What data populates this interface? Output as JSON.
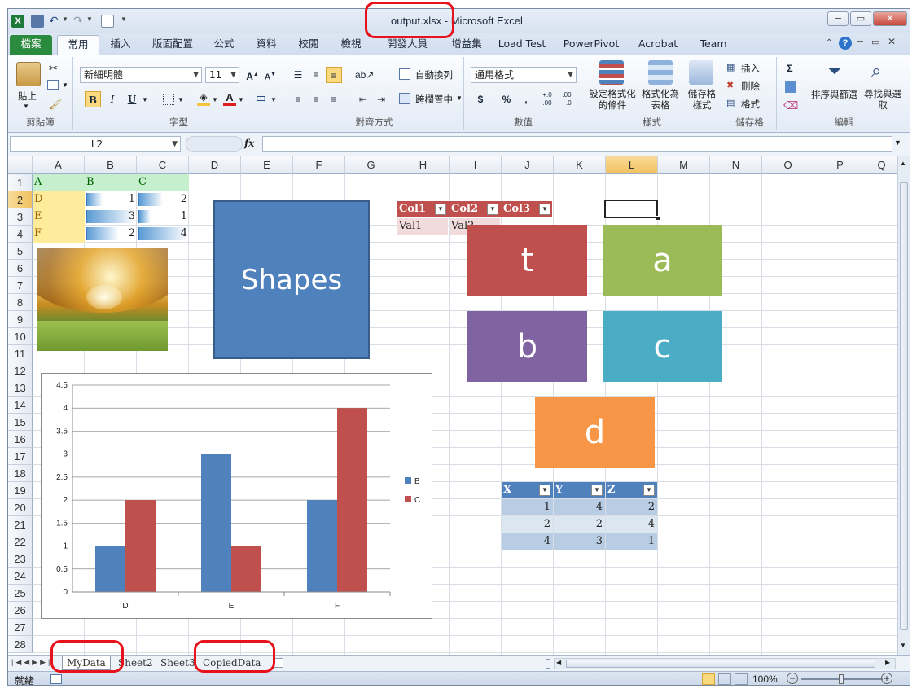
{
  "window": {
    "title": "output.xlsx - Microsoft Excel"
  },
  "tabs": [
    {
      "label": "檔案"
    },
    {
      "label": "常用"
    },
    {
      "label": "插入"
    },
    {
      "label": "版面配置"
    },
    {
      "label": "公式"
    },
    {
      "label": "資料"
    },
    {
      "label": "校閱"
    },
    {
      "label": "檢視"
    },
    {
      "label": "開發人員"
    },
    {
      "label": "增益集"
    },
    {
      "label": "Load Test"
    },
    {
      "label": "PowerPivot"
    },
    {
      "label": "Acrobat"
    },
    {
      "label": "Team"
    }
  ],
  "ribbon": {
    "clipboard": {
      "paste": "貼上",
      "label": "剪貼簿"
    },
    "font": {
      "name": "新細明體",
      "size": "11",
      "bold": "B",
      "italic": "I",
      "underline": "U",
      "label": "字型"
    },
    "alignment": {
      "wrap": "自動換列",
      "merge": "跨欄置中",
      "label": "對齊方式"
    },
    "number": {
      "format": "通用格式",
      "currency": "$",
      "percent": "%",
      "comma": ",",
      "inc": "+.0 .00",
      "dec": ".00 +.0",
      "label": "數值"
    },
    "styles": {
      "conditional": "設定格式化的條件",
      "as_table": "格式化為表格",
      "cell_styles": "儲存格樣式",
      "label": "樣式"
    },
    "cells": {
      "insert": "插入",
      "delete": "刪除",
      "format": "格式",
      "label": "儲存格"
    },
    "editing": {
      "sum": "Σ",
      "sort": "排序與篩選",
      "find": "尋找與選取",
      "label": "編輯"
    }
  },
  "formula_bar": {
    "name_box": "L2",
    "fx": "fx",
    "formula": ""
  },
  "columns": [
    "A",
    "B",
    "C",
    "D",
    "E",
    "F",
    "G",
    "H",
    "I",
    "J",
    "K",
    "L",
    "M",
    "N",
    "O",
    "P",
    "Q"
  ],
  "rows": [
    "1",
    "2",
    "3",
    "4",
    "5",
    "6",
    "7",
    "8",
    "9",
    "10",
    "11",
    "12",
    "13",
    "14",
    "15",
    "16",
    "17",
    "18",
    "19",
    "20",
    "21",
    "22",
    "23",
    "24",
    "25",
    "26",
    "27",
    "28"
  ],
  "cells": {
    "a1": "A",
    "b1": "B",
    "c1": "C",
    "a2": "D",
    "a3": "E",
    "a4": "F",
    "b2": "1",
    "b3": "3",
    "b4": "2",
    "c2": "2",
    "c3": "1",
    "c4": "4"
  },
  "databars": {
    "b": [
      0.33,
      1.0,
      0.67
    ],
    "c": [
      0.5,
      0.25,
      1.0
    ]
  },
  "table1": {
    "headers": [
      "Col1",
      "Col2",
      "Col3"
    ],
    "row": [
      "Val1",
      "Val2",
      ""
    ]
  },
  "table2": {
    "headers": [
      "X",
      "Y",
      "Z"
    ],
    "rows": [
      [
        "1",
        "4",
        "2"
      ],
      [
        "2",
        "2",
        "4"
      ],
      [
        "4",
        "3",
        "1"
      ]
    ]
  },
  "shapes": {
    "main": {
      "text": "Shapes",
      "color": "#4f81bd"
    },
    "t": {
      "text": "t",
      "color": "#c0504d"
    },
    "a": {
      "text": "a",
      "color": "#9bbb59"
    },
    "b": {
      "text": "b",
      "color": "#8064a2"
    },
    "c": {
      "text": "c",
      "color": "#4bacc6"
    },
    "d": {
      "text": "d",
      "color": "#f79646"
    }
  },
  "chart_data": {
    "type": "bar",
    "categories": [
      "D",
      "E",
      "F"
    ],
    "series": [
      {
        "name": "B",
        "values": [
          1,
          3,
          2
        ],
        "color": "#4f81bd"
      },
      {
        "name": "C",
        "values": [
          2,
          1,
          4
        ],
        "color": "#c0504d"
      }
    ],
    "ylim": [
      0,
      4.5
    ],
    "yticks": [
      "0",
      "0.5",
      "1",
      "1.5",
      "2",
      "2.5",
      "3",
      "3.5",
      "4",
      "4.5"
    ],
    "grid": true,
    "legend": "right",
    "title": "",
    "xlabel": "",
    "ylabel": ""
  },
  "sheets": [
    "MyData",
    "Sheet2",
    "Sheet3",
    "CopiedData"
  ],
  "status": {
    "ready": "就緒",
    "zoom": "100%"
  }
}
